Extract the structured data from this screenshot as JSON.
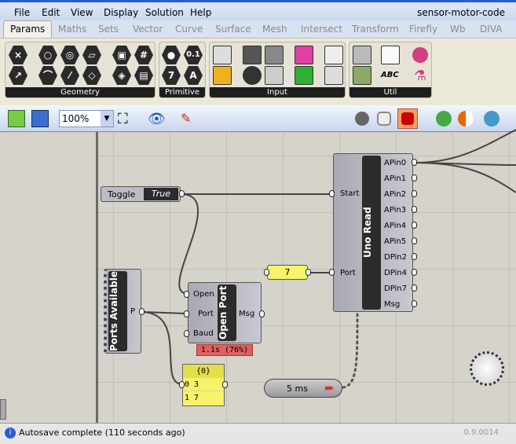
{
  "menu": {
    "items": [
      "File",
      "Edit",
      "View",
      "Display",
      "Solution",
      "Help"
    ],
    "doc_title": "sensor-motor-code"
  },
  "tabs": [
    "Params",
    "Maths",
    "Sets",
    "Vector",
    "Curve",
    "Surface",
    "Mesh",
    "Intersect",
    "Transform",
    "Firefly",
    "Wb",
    "DIVA"
  ],
  "ribbon": {
    "groups": [
      "Geometry",
      "Primitive",
      "Input",
      "Util"
    ],
    "primitive_glyphs": [
      "0.1",
      "7",
      "A"
    ],
    "abc_glyph": "ABC"
  },
  "toolbar": {
    "zoom": "100%"
  },
  "canvas": {
    "toggle": {
      "label": "Toggle",
      "value": "True"
    },
    "uno": {
      "title": "Uno Read",
      "inputs": [
        "Start",
        "Port"
      ],
      "outputs": [
        "APin0",
        "APin1",
        "APin2",
        "APin3",
        "APin4",
        "APin5",
        "DPin2",
        "DPin4",
        "DPin7",
        "Msg"
      ]
    },
    "number": {
      "value": "7"
    },
    "ports": {
      "title": "Ports Available",
      "output": "P"
    },
    "open": {
      "title": "Open Port",
      "inputs": [
        "Open",
        "Port",
        "Baud"
      ],
      "output": "Msg",
      "profile": "1.1s (76%)"
    },
    "panel": {
      "header": "{0}",
      "rows": [
        {
          "i": "0",
          "v": "3"
        },
        {
          "i": "1",
          "v": "7"
        }
      ]
    },
    "timer": {
      "label": "5 ms"
    }
  },
  "status": {
    "message": "Autosave complete (110 seconds ago)",
    "version": "0.9.0014"
  },
  "colors": {
    "accent": "#2a5bd7",
    "panel": "#f7f36a",
    "profile": "#e06060"
  }
}
